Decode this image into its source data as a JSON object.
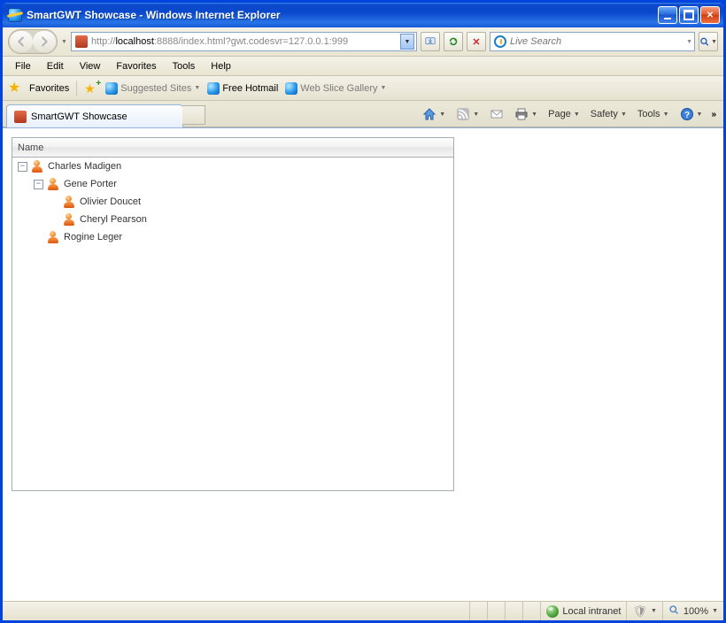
{
  "window": {
    "title": "SmartGWT Showcase - Windows Internet Explorer"
  },
  "address": {
    "pre": "http://",
    "host": "localhost",
    "rest": ":8888/index.html?gwt.codesvr=127.0.0.1:999"
  },
  "search": {
    "placeholder": "Live Search"
  },
  "menu": {
    "file": "File",
    "edit": "Edit",
    "view": "View",
    "favorites": "Favorites",
    "tools": "Tools",
    "help": "Help"
  },
  "favbar": {
    "favorites": "Favorites",
    "suggested": "Suggested Sites",
    "hotmail": "Free Hotmail",
    "webslice": "Web Slice Gallery"
  },
  "tab": {
    "title": "SmartGWT Showcase"
  },
  "command": {
    "page": "Page",
    "safety": "Safety",
    "tools": "Tools"
  },
  "tree": {
    "header": "Name",
    "rows": [
      {
        "indent": 0,
        "toggle": "minus",
        "label": "Charles Madigen"
      },
      {
        "indent": 1,
        "toggle": "minus",
        "label": "Gene Porter"
      },
      {
        "indent": 2,
        "toggle": "leaf",
        "label": "Olivier Doucet"
      },
      {
        "indent": 2,
        "toggle": "leaf",
        "label": "Cheryl Pearson"
      },
      {
        "indent": 1,
        "toggle": "leaf",
        "label": "Rogine Leger"
      }
    ]
  },
  "status": {
    "zone": "Local intranet",
    "zoom": "100%"
  }
}
